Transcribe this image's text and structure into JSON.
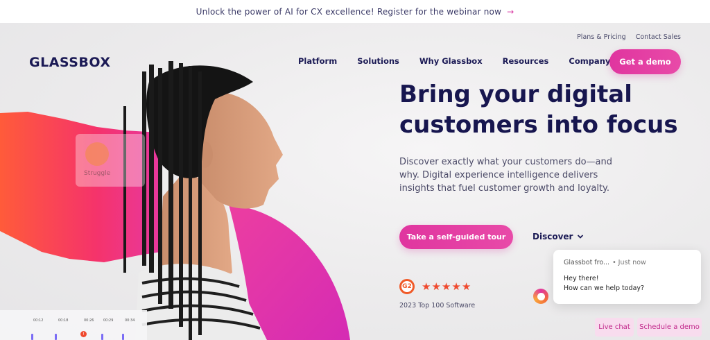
{
  "announcement": {
    "text": "Unlock the power of AI for CX excellence! Register for the webinar now",
    "arrow": "→"
  },
  "utility_nav": {
    "plans": "Plans & Pricing",
    "contact": "Contact Sales"
  },
  "logo": "GLASSBOX",
  "nav": {
    "items": [
      "Platform",
      "Solutions",
      "Why Glassbox",
      "Resources",
      "Company"
    ]
  },
  "cta_demo": "Get a demo",
  "hero": {
    "headline_1": "Bring your digital",
    "headline_2": "customers into focus",
    "description": "Discover exactly what your customers do—and why. Digital experience intelligence delivers insights that fuel customer growth and loyalty.",
    "tour_button": "Take a self-guided tour",
    "discover": "Discover"
  },
  "g2": {
    "logo": "G2",
    "rating_stars": 5,
    "caption": "2023 Top 100 Software"
  },
  "struggle_card": {
    "label": "Struggle"
  },
  "timeline": {
    "labels": [
      "00:12",
      "00:18",
      "00:26",
      "00:29",
      "00:34"
    ]
  },
  "chat": {
    "sender": "Glassbot fro...",
    "time": "• Just now",
    "line1": "Hey there!",
    "line2": "How can we help today?"
  },
  "chips": {
    "live_chat": "Live chat",
    "schedule_demo": "Schedule a demo"
  },
  "colors": {
    "brand_pink": "#e0359f",
    "navy": "#1b1a55",
    "orange": "#f05a28"
  },
  "icons": {
    "discover": "chevron-down-icon",
    "announce": "arrow-right-icon",
    "g2": "g2-logo-icon"
  }
}
